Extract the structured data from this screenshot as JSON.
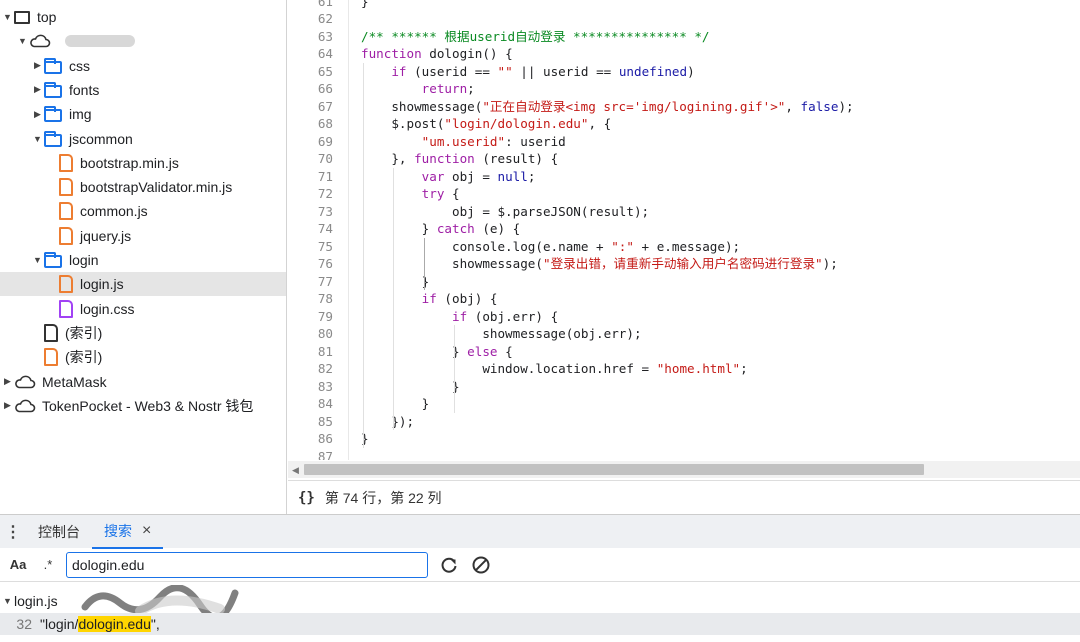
{
  "tree": {
    "nodes": [
      {
        "label": "top",
        "depth": 0,
        "expanded": true,
        "icon": "frame"
      },
      {
        "label": "",
        "depth": 1,
        "expanded": true,
        "icon": "cloud",
        "redacted": true
      },
      {
        "label": "css",
        "depth": 2,
        "expanded": false,
        "icon": "folder"
      },
      {
        "label": "fonts",
        "depth": 2,
        "expanded": false,
        "icon": "folder"
      },
      {
        "label": "img",
        "depth": 2,
        "expanded": false,
        "icon": "folder"
      },
      {
        "label": "jscommon",
        "depth": 2,
        "expanded": true,
        "icon": "folder"
      },
      {
        "label": "bootstrap.min.js",
        "depth": 3,
        "icon": "file-js"
      },
      {
        "label": "bootstrapValidator.min.js",
        "depth": 3,
        "icon": "file-js"
      },
      {
        "label": "common.js",
        "depth": 3,
        "icon": "file-js"
      },
      {
        "label": "jquery.js",
        "depth": 3,
        "icon": "file-js"
      },
      {
        "label": "login",
        "depth": 2,
        "expanded": true,
        "icon": "folder"
      },
      {
        "label": "login.js",
        "depth": 3,
        "icon": "file-js",
        "selected": true
      },
      {
        "label": "login.css",
        "depth": 3,
        "icon": "file-css"
      },
      {
        "label": "(索引)",
        "depth": 2,
        "icon": "file-plain"
      },
      {
        "label": "(索引)",
        "depth": 2,
        "icon": "file-js"
      },
      {
        "label": "MetaMask",
        "depth": 0,
        "expanded": false,
        "icon": "cloud"
      },
      {
        "label": "TokenPocket - Web3 & Nostr 钱包",
        "depth": 0,
        "expanded": false,
        "icon": "cloud"
      }
    ]
  },
  "editor": {
    "lines": [
      {
        "num": "61",
        "code": "}"
      },
      {
        "num": "62",
        "code": ""
      },
      {
        "num": "63",
        "code": "/** ****** 根据userid自动登录 *************** */"
      },
      {
        "num": "64",
        "code": "function dologin() {"
      },
      {
        "num": "65",
        "code": "    if (userid == \"\" || userid == undefined)"
      },
      {
        "num": "66",
        "code": "        return;"
      },
      {
        "num": "67",
        "code": "    showmessage(\"正在自动登录<img src='img/logining.gif'>\", false);"
      },
      {
        "num": "68",
        "code": "    $.post(\"login/dologin.edu\", {"
      },
      {
        "num": "69",
        "code": "        \"um.userid\": userid"
      },
      {
        "num": "70",
        "code": "    }, function (result) {"
      },
      {
        "num": "71",
        "code": "        var obj = null;"
      },
      {
        "num": "72",
        "code": "        try {"
      },
      {
        "num": "73",
        "code": "            obj = $.parseJSON(result);"
      },
      {
        "num": "74",
        "code": "        } catch (e) {"
      },
      {
        "num": "75",
        "code": "            console.log(e.name + \":\" + e.message);"
      },
      {
        "num": "76",
        "code": "            showmessage(\"登录出错，请重新手动输入用户名密码进行登录\");"
      },
      {
        "num": "77",
        "code": "        }"
      },
      {
        "num": "78",
        "code": "        if (obj) {"
      },
      {
        "num": "79",
        "code": "            if (obj.err) {"
      },
      {
        "num": "80",
        "code": "                showmessage(obj.err);"
      },
      {
        "num": "81",
        "code": "            } else {"
      },
      {
        "num": "82",
        "code": "                window.location.href = \"home.html\";"
      },
      {
        "num": "83",
        "code": "            }"
      },
      {
        "num": "84",
        "code": "        }"
      },
      {
        "num": "85",
        "code": "    });"
      },
      {
        "num": "86",
        "code": "}"
      },
      {
        "num": "87",
        "code": ""
      }
    ]
  },
  "status": {
    "brace": "{}",
    "position": "第 74 行，第 22 列"
  },
  "drawer": {
    "menu_glyph": "⋮",
    "tabs": [
      {
        "label": "控制台",
        "active": false
      },
      {
        "label": "搜索",
        "active": true,
        "closable": true
      }
    ],
    "close_glyph": "×"
  },
  "search": {
    "case_toggle": "Aa",
    "regex_toggle": ".*",
    "value": "dologin.edu",
    "placeholder": ""
  },
  "results": {
    "file": "login.js",
    "line_num": "32",
    "prefix": "\"login/",
    "match": "dologin.edu",
    "suffix": "\","
  },
  "colors": {
    "accent": "#1a73e8",
    "comment": "#0a8a22",
    "keyword": "#9e1ea5",
    "string": "#c41a16",
    "highlight": "#ffd500"
  }
}
